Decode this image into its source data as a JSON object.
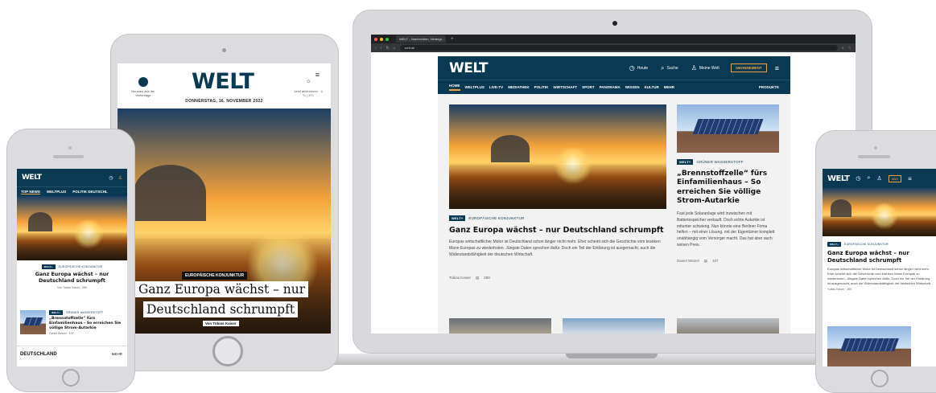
{
  "brand": {
    "logo": "WELT",
    "navy": "#0a3954",
    "accent": "#f0a33c"
  },
  "laptop": {
    "browser": {
      "tab_title": "WELT – Nachrichten, Hintergr...",
      "url": "welt.de"
    },
    "header": {
      "today_label": "Heute",
      "search_label": "Suche",
      "account_label": "Meine Welt",
      "subscribe_label": "ABONNEMENT"
    },
    "nav": [
      "HOME",
      "WELTPLUS",
      "LIVE-TV",
      "MEDIATHEK",
      "POLITIK",
      "WIRTSCHAFT",
      "SPORT",
      "PANORAMA",
      "WISSEN",
      "KULTUR",
      "MEHR"
    ],
    "nav_right": "PRODUKTE",
    "lead": {
      "badge": "WELT+",
      "kicker": "EUROPÄISCHE KONJUNKTUR",
      "headline": "Ganz Europa wächst – nur Deutschland schrumpft",
      "teaser": "Europas wirtschaftlicher Motor ist Deutschland schon länger nicht mehr. Eher scheint sich die Geschichte vom kranken Mann Europas zu wiederholen. Jüngste Daten sprechen dafür. Doch ein Teil der Erklärung ist ausgemacht, auch die Widerstandsfähigkeit der deutschen Wirtschaft.",
      "author": "Tobias Kaiser",
      "comments": "289"
    },
    "side": {
      "badge": "WELT+",
      "kicker": "GRÜNER WASSERSTOFF",
      "headline": "„Brennstoffzelle“ fürs Einfamilienhaus – So erreichen Sie völlige Strom-Autarkie",
      "teaser": "Fast jede Solaranlage wird inzwischen mit Batteriespeicher verkauft. Doch echte Autarkie ist mitunter schwierig. Nun könnte eine Berliner Firma helfen – mit einer Lösung, mit der Eigentümer komplett unabhängig vom Versorger macht. Das hat aber auch seinen Preis.",
      "author": "Daniel Wetzel",
      "comments": "107"
    }
  },
  "tablet": {
    "left_label": "Neustes aus der Wetterlage",
    "right_label": "Jetzt abonnieren · 4 °C | 6°C",
    "date": "DONNERSTAG, 16. NOVEMBER 2022",
    "kicker": "EUROPÄISCHE KONJUNKTUR",
    "headline_1": "Ganz Europa wächst – nur",
    "headline_2": "Deutschland schrumpft",
    "byline": "Von Tobias Kaiser"
  },
  "phone_left": {
    "tabs": [
      "TOP NEWS",
      "WELTPLUS",
      "POLITIK DEUTSCHL"
    ],
    "kicker": "EUROPÄISCHE KONJUNKTUR",
    "headline": "Ganz Europa wächst – nur Deutschland schrumpft",
    "byline": "Von Tobias Kaiser · 289",
    "item_kicker": "GRÜNER WASSERSTOFF",
    "item_headline": "„Brennstoffzelle“ fürs Einfamilienhaus – So erreichen Sie völlige Strom-Autarkie",
    "item_meta": "Daniel Wetzel · 107",
    "section": "DEUTSCHLAND",
    "section_more": "MEHR"
  },
  "phone_right": {
    "abo_label": "ABO",
    "kicker": "EUROPÄISCHE KONJUNKTUR",
    "headline": "Ganz Europa wächst – nur Deutschland schrumpft",
    "teaser": "Europas wirtschaftlicher Motor ist Deutschland schon länger nicht mehr. Eher scheint sich die Geschichte vom kranken Mann Europas zu wiederholen. Jüngste Daten sprechen dafür. Doch ein Teil der Erklärung ist ausgemacht, auch die Widerstandsfähigkeit der deutschen Wirtschaft.",
    "meta": "Tobias Kaiser · 289"
  }
}
